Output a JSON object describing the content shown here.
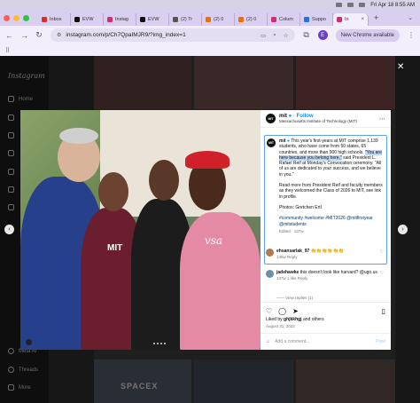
{
  "menubar": {
    "datetime": "Fri Apr 18  8:55 AM"
  },
  "tabs": [
    {
      "label": "Inbox",
      "favicon_color": "#d93025"
    },
    {
      "label": "EVW",
      "favicon_color": "#111111"
    },
    {
      "label": "Instag",
      "favicon_color": "#d62976"
    },
    {
      "label": "EVW",
      "favicon_color": "#111111"
    },
    {
      "label": "(2) Tr",
      "favicon_color": "#555555"
    },
    {
      "label": "(2) 0",
      "favicon_color": "#e8710a"
    },
    {
      "label": "(2) 0",
      "favicon_color": "#e8710a"
    },
    {
      "label": "Colum",
      "favicon_color": "#d62976"
    },
    {
      "label": "Suppo",
      "favicon_color": "#1a73e8"
    },
    {
      "label": "In",
      "favicon_color": "#d62976",
      "active": true
    }
  ],
  "toolbar": {
    "url": "instagram.com/p/Ch7QpaIMJR9/?img_index=1",
    "update_button": "New Chrome available",
    "profile_initial": "E"
  },
  "sidebar": {
    "logo": "Instagram",
    "items": [
      {
        "label": "Home"
      },
      {
        "label": "Meta AI"
      },
      {
        "label": "Threads"
      },
      {
        "label": "More"
      }
    ]
  },
  "grid": {
    "visible_text": "SPACEX"
  },
  "photo": {
    "shirt_text_left": "MIT",
    "shirt_text_right": "vsa"
  },
  "post": {
    "account": "mit",
    "account_subtitle": "Massachusetts Institute of Technology (MIT)",
    "follow_label": "Follow",
    "avatar_text": "MIT",
    "caption_intro": "This year's first-years at MIT comprise 1,139 students, who have come from 50 states, 65 countries, and more than 900 high schools.",
    "caption_highlight": "\"You are here because you belong here,\"",
    "caption_rest": " said President L. Rafael Reif at Monday's Convocation ceremony. \"All of us are dedicated to your success, and we believe in you.\"",
    "caption_p2": "Read more from President Reif and faculty members as they welcomed the Class of 2026 to MIT, see link in profile.",
    "caption_p3": "Photos: Gretchen Ertl",
    "hashtags": "#community #welcome #MIT2026 @mitfirstyear @mitstudents",
    "edited": "Edited · 137w",
    "comments": [
      {
        "user": "ehsansarlak_97",
        "text": "👏👏👏👏👏👏",
        "meta": "136w   Reply",
        "avatar_color": "#b07a4a"
      },
      {
        "user": "jadehawke",
        "text": "this doesn't look like harvard? @ugo.us",
        "meta": "137w   1 like   Reply",
        "avatar_color": "#6a8fb0"
      }
    ],
    "view_replies": "—— View replies (1)",
    "liked_by_prefix": "Liked by ",
    "liked_by_user": "ghjkkhgj",
    "liked_by_suffix": " and others",
    "date": "August 31, 2022",
    "add_comment_placeholder": "Add a comment...",
    "post_label": "Post"
  }
}
